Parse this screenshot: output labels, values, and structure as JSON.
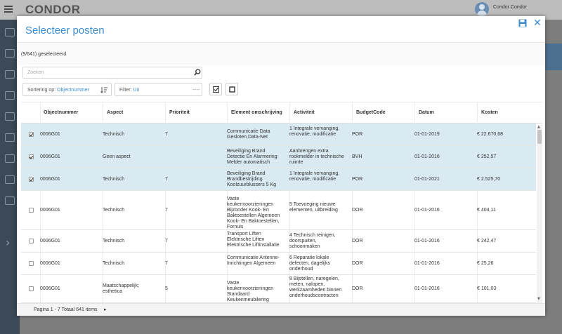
{
  "app": {
    "logo": "CONDOR",
    "user_name": "Condor Condor"
  },
  "modal": {
    "title": "Selecteer posten",
    "selected_count": "(9/641) geselecteerd",
    "search_placeholder": "Zoeken",
    "sort_label": "Sortering op:",
    "sort_value": "Objectnummer",
    "filter_label": "Filter:",
    "filter_value": "Uit",
    "filter_dash": "----"
  },
  "table": {
    "columns": [
      "Objectnummer",
      "Aspect",
      "Prioriteit",
      "Element omschrijving",
      "Activiteit",
      "BudgetCode",
      "Datum",
      "Kosten"
    ],
    "rows": [
      {
        "checked": true,
        "objectnummer": "0006G01",
        "aspect": "Technisch",
        "prioriteit": "7",
        "element": "Communicatie Data Gesloten Data-Net",
        "activiteit": "1 Integrale vervanging, renovatie, modificatie",
        "budgetcode": "POR",
        "datum": "01-01-2019",
        "kosten": "€ 22.670,68"
      },
      {
        "checked": true,
        "objectnummer": "0006G01",
        "aspect": "Geen aspect",
        "prioriteit": "",
        "element": "Beveiliging Brand Detectie En Alarmering Melder automatisch",
        "activiteit": "Aanbrengen extra rookmelder in technische ruimte",
        "budgetcode": "BVH",
        "datum": "01-01-2016",
        "kosten": "€ 252,57"
      },
      {
        "checked": true,
        "objectnummer": "0006G01",
        "aspect": "Technisch",
        "prioriteit": "7",
        "element": "Beveiliging Brand Brandbestrijding Koolzuurblussers 5 Kg",
        "activiteit": "1 Integrale vervanging, renovatie, modificatie",
        "budgetcode": "POR",
        "datum": "01-01-2021",
        "kosten": "€ 2.525,70"
      },
      {
        "checked": false,
        "objectnummer": "0006G01",
        "aspect": "Technisch",
        "prioriteit": "7",
        "element": "Vaste keukenvoorzieningen Bijzonder Kook- En Baktoestellen Algemeen Kook- En Baktoestellen, Fornuis",
        "activiteit": "5 Toevoeging nieuwe elementen, uitbreiding",
        "budgetcode": "DOR",
        "datum": "01-01-2016",
        "kosten": "€ 404,11"
      },
      {
        "checked": false,
        "objectnummer": "0006G01",
        "aspect": "Technisch",
        "prioriteit": "7",
        "element": "Transport Liften Elektrische Liften Elektrische Liftinstallatie",
        "activiteit": "4 Technisch reinigen, doorspuiten, schoonmaken",
        "budgetcode": "DOR",
        "datum": "01-01-2016",
        "kosten": "€ 242,47"
      },
      {
        "checked": false,
        "objectnummer": "0006G01",
        "aspect": "Technisch",
        "prioriteit": "7",
        "element": "Communicatie Antenne-Inrichtingen Algemeen",
        "activiteit": "6 Reparatie lokale defecten, dagelijks onderhoud",
        "budgetcode": "DOR",
        "datum": "01-01-2016",
        "kosten": "€ 25,26"
      },
      {
        "checked": false,
        "objectnummer": "0006G01",
        "aspect": "Maatschappelijk; esthetica",
        "prioriteit": "5",
        "element": "Vaste keukenvoorzieningen Standaard Keukenmeubilering",
        "activiteit": "8 Bijstellen, naregelen, meten, nalopen, werkzaamheden binnen onderhoudscontracten",
        "budgetcode": "DOR",
        "datum": "01-01-2016",
        "kosten": "€ 101,03"
      }
    ]
  },
  "footer": {
    "pager_text": "Pagina 1 - 7 Totaal 641 items",
    "next_glyph": "▸"
  },
  "colors": {
    "accent": "#3b8ccf",
    "selected_row": "#d9eaf3",
    "sidebar": "#3c4a58"
  }
}
